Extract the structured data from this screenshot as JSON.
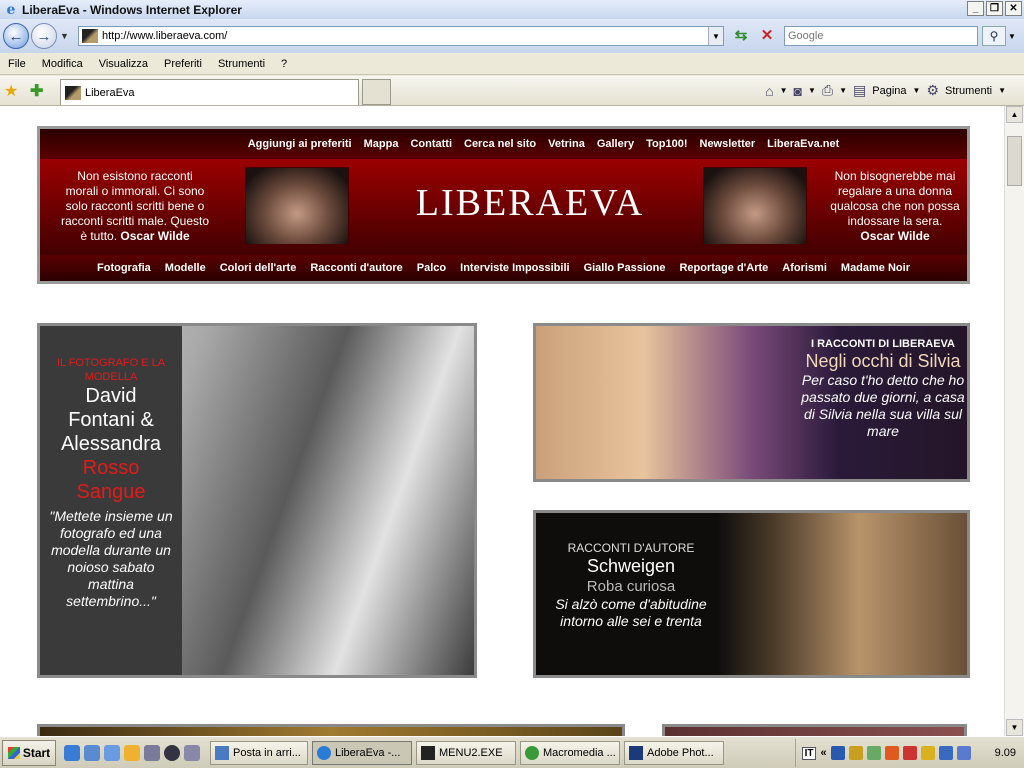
{
  "window": {
    "title": "LiberaEva - Windows Internet Explorer",
    "buttons": {
      "minimize": "_",
      "maximize": "❐",
      "close": "✕"
    }
  },
  "address_bar": {
    "url": "http://www.liberaeva.com/",
    "search_placeholder": "Google"
  },
  "menu": [
    "File",
    "Modifica",
    "Visualizza",
    "Preferiti",
    "Strumenti",
    "?"
  ],
  "tab": {
    "label": "LiberaEva"
  },
  "toolbar": {
    "page_label": "Pagina",
    "tools_label": "Strumenti"
  },
  "site": {
    "top_nav": [
      "Aggiungi ai preferiti",
      "Mappa",
      "Contatti",
      "Cerca nel sito",
      "Vetrina",
      "Gallery",
      "Top100!",
      "Newsletter",
      "LiberaEva.net"
    ],
    "logo": "LIBERAEVA",
    "quote_left": {
      "text": "Non esistono racconti morali o immorali. Ci sono solo racconti scritti bene o racconti scritti male. Questo è tutto.",
      "author": "Oscar Wilde"
    },
    "quote_right": {
      "text": "Non bisognerebbe mai regalare a una donna qualcosa che non possa indossare la sera.",
      "author": "Oscar Wilde"
    },
    "bottom_nav": [
      "Fotografia",
      "Modelle",
      "Colori dell'arte",
      "Racconti d'autore",
      "Palco",
      "Interviste Impossibili",
      "Giallo Passione",
      "Reportage d'Arte",
      "Aforismi",
      "Madame Noir"
    ]
  },
  "features": {
    "card1": {
      "category": "IL FOTOGRAFO E LA MODELLA",
      "line1": "David",
      "line2": "Fontani  &",
      "line3": "Alessandra",
      "line4": "Rosso",
      "line5": "Sangue",
      "desc": "\"Mettete insieme un fotografo ed una modella durante un noioso sabato mattina settembrino...\""
    },
    "card2": {
      "category": "I RACCONTI DI LIBERAEVA",
      "title": "Negli occhi di Silvia",
      "desc": "Per caso t'ho detto che ho passato due giorni, a casa di Silvia nella sua villa sul mare"
    },
    "card3": {
      "category": "RACCONTI D'AUTORE",
      "title": "Schweigen",
      "subtitle": "Roba curiosa",
      "desc": "Si alzò come d'abitudine intorno alle sei e trenta"
    }
  },
  "taskbar": {
    "start": "Start",
    "items": [
      "Posta in arri...",
      "LiberaEva -...",
      "MENU2.EXE",
      "Macromedia ...",
      "Adobe Phot..."
    ],
    "lang": "IT",
    "clock": "9.09"
  }
}
